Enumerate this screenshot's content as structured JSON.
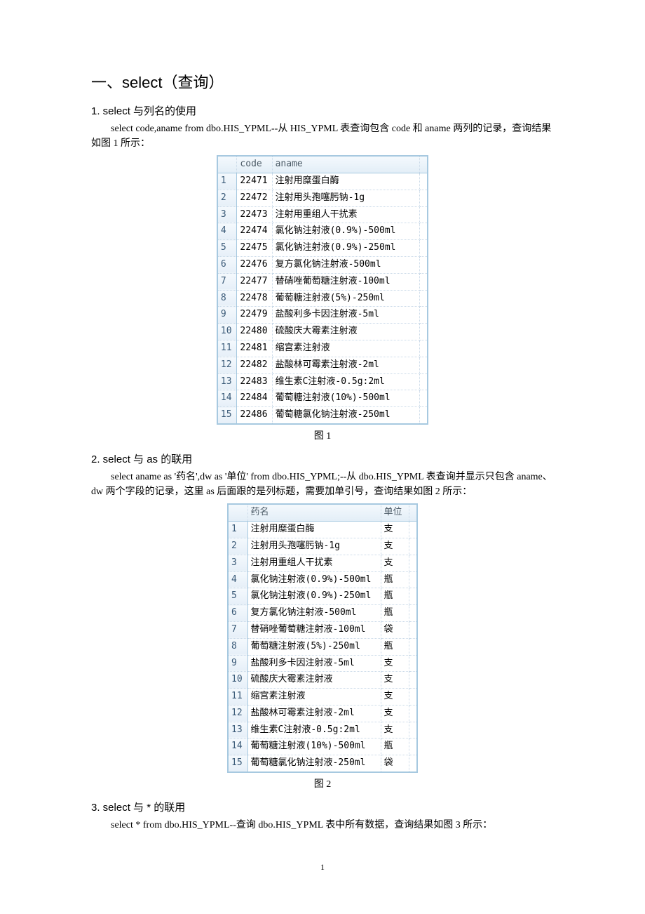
{
  "section_title": "一、select（查询）",
  "sub1": {
    "heading": "1.  select 与列名的使用",
    "text": "select code,aname from dbo.HIS_YPML--从 HIS_YPML 表查询包含 code 和 aname 两列的记录，查询结果如图 1 所示："
  },
  "table1": {
    "headers": {
      "code": "code",
      "aname": "aname"
    },
    "rows": [
      {
        "n": "1",
        "code": "22471",
        "aname": "注射用糜蛋白酶"
      },
      {
        "n": "2",
        "code": "22472",
        "aname": "注射用头孢噻肟钠-1g"
      },
      {
        "n": "3",
        "code": "22473",
        "aname": "注射用重组人干扰素"
      },
      {
        "n": "4",
        "code": "22474",
        "aname": "氯化钠注射液(0.9%)-500ml"
      },
      {
        "n": "5",
        "code": "22475",
        "aname": "氯化钠注射液(0.9%)-250ml"
      },
      {
        "n": "6",
        "code": "22476",
        "aname": "复方氯化钠注射液-500ml"
      },
      {
        "n": "7",
        "code": "22477",
        "aname": "替硝唑葡萄糖注射液-100ml"
      },
      {
        "n": "8",
        "code": "22478",
        "aname": "葡萄糖注射液(5%)-250ml"
      },
      {
        "n": "9",
        "code": "22479",
        "aname": "盐酸利多卡因注射液-5ml"
      },
      {
        "n": "10",
        "code": "22480",
        "aname": "硫酸庆大霉素注射液"
      },
      {
        "n": "11",
        "code": "22481",
        "aname": "缩宫素注射液"
      },
      {
        "n": "12",
        "code": "22482",
        "aname": "盐酸林可霉素注射液-2ml"
      },
      {
        "n": "13",
        "code": "22483",
        "aname": "维生素C注射液-0.5g:2ml"
      },
      {
        "n": "14",
        "code": "22484",
        "aname": "葡萄糖注射液(10%)-500ml"
      },
      {
        "n": "15",
        "code": "22486",
        "aname": "葡萄糖氯化钠注射液-250ml"
      }
    ]
  },
  "caption1": "图 1",
  "sub2": {
    "heading": "2.  select 与 as 的联用",
    "text": "select aname as '药名',dw as '单位' from dbo.HIS_YPML;--从 dbo.HIS_YPML 表查询并显示只包含 aname、dw 两个字段的记录，这里 as 后面跟的是列标题，需要加单引号，查询结果如图 2 所示："
  },
  "table2": {
    "headers": {
      "name": "药名",
      "dw": "单位"
    },
    "rows": [
      {
        "n": "1",
        "name": "注射用糜蛋白酶",
        "dw": "支"
      },
      {
        "n": "2",
        "name": "注射用头孢噻肟钠-1g",
        "dw": "支"
      },
      {
        "n": "3",
        "name": "注射用重组人干扰素",
        "dw": "支"
      },
      {
        "n": "4",
        "name": "氯化钠注射液(0.9%)-500ml",
        "dw": "瓶"
      },
      {
        "n": "5",
        "name": "氯化钠注射液(0.9%)-250ml",
        "dw": "瓶"
      },
      {
        "n": "6",
        "name": "复方氯化钠注射液-500ml",
        "dw": "瓶"
      },
      {
        "n": "7",
        "name": "替硝唑葡萄糖注射液-100ml",
        "dw": "袋"
      },
      {
        "n": "8",
        "name": "葡萄糖注射液(5%)-250ml",
        "dw": "瓶"
      },
      {
        "n": "9",
        "name": "盐酸利多卡因注射液-5ml",
        "dw": "支"
      },
      {
        "n": "10",
        "name": "硫酸庆大霉素注射液",
        "dw": "支"
      },
      {
        "n": "11",
        "name": "缩宫素注射液",
        "dw": "支"
      },
      {
        "n": "12",
        "name": "盐酸林可霉素注射液-2ml",
        "dw": "支"
      },
      {
        "n": "13",
        "name": "维生素C注射液-0.5g:2ml",
        "dw": "支"
      },
      {
        "n": "14",
        "name": "葡萄糖注射液(10%)-500ml",
        "dw": "瓶"
      },
      {
        "n": "15",
        "name": "葡萄糖氯化钠注射液-250ml",
        "dw": "袋"
      }
    ]
  },
  "caption2": "图 2",
  "sub3": {
    "heading": "3.  select 与 * 的联用",
    "text": "select * from dbo.HIS_YPML--查询 dbo.HIS_YPML 表中所有数据，查询结果如图 3 所示："
  },
  "page_number": "1"
}
